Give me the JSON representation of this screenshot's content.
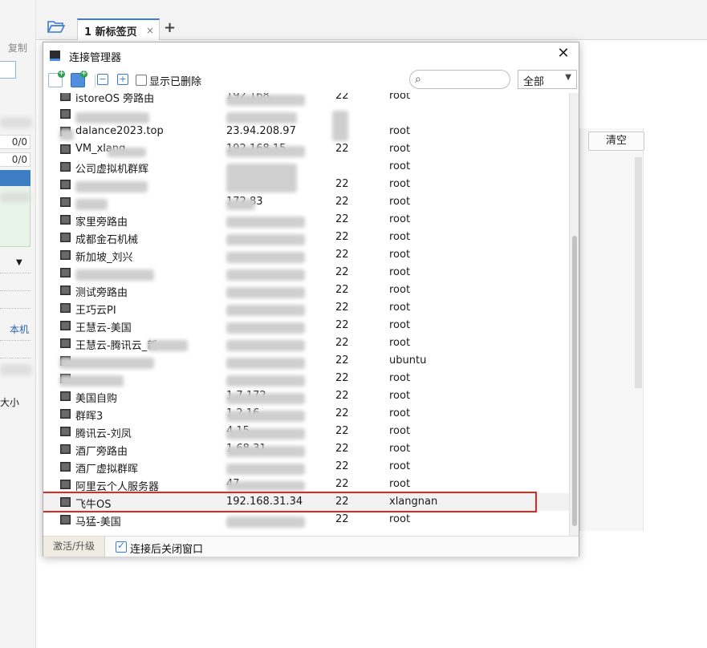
{
  "background": {
    "copy_label": "复制",
    "left_values": [
      "0/0",
      "0/0"
    ],
    "local_label": "本机",
    "size_label": "大小",
    "tab": {
      "label": "1 新标签页",
      "close": "×",
      "add": "+"
    },
    "clear_button": "清空"
  },
  "dialog": {
    "title": "连接管理器",
    "close": "✕",
    "toolbar": {
      "show_deleted_label": "显示已删除",
      "search_placeholder": "",
      "filter_value": "全部"
    },
    "connections": [
      {
        "name": "istoreOS 旁路由",
        "host": "192.168.",
        "port": "22",
        "user": "root"
      },
      {
        "name": "",
        "host": "",
        "port": "",
        "user": ""
      },
      {
        "name": "dalance2023.top",
        "host": "23.94.208.97",
        "port": "",
        "user": "root"
      },
      {
        "name": "VM_xlang",
        "host": "192.168.15.",
        "port": "22",
        "user": "root"
      },
      {
        "name": "公司虚拟机群辉",
        "host": "",
        "port": "",
        "user": "root"
      },
      {
        "name": "",
        "host": "",
        "port": "22",
        "user": "root"
      },
      {
        "name": "",
        "host": "172.83",
        "port": "22",
        "user": "root"
      },
      {
        "name": "家里旁路由",
        "host": "",
        "port": "22",
        "user": "root"
      },
      {
        "name": "成都金石机械",
        "host": "",
        "port": "22",
        "user": "root"
      },
      {
        "name": "新加坡_刘兴",
        "host": "",
        "port": "22",
        "user": "root"
      },
      {
        "name": "",
        "host": "",
        "port": "22",
        "user": "root"
      },
      {
        "name": "测试旁路由",
        "host": "",
        "port": "22",
        "user": "root"
      },
      {
        "name": "王巧云PI",
        "host": "",
        "port": "22",
        "user": "root"
      },
      {
        "name": "王慧云-美国",
        "host": "",
        "port": "22",
        "user": "root"
      },
      {
        "name": "王慧云-腾讯云_新",
        "host": "",
        "port": "22",
        "user": "root"
      },
      {
        "name": "",
        "host": "",
        "port": "22",
        "user": "ubuntu"
      },
      {
        "name": "",
        "host": "",
        "port": "22",
        "user": "root"
      },
      {
        "name": "美国自购",
        "host": "1 7.172",
        "port": "22",
        "user": "root"
      },
      {
        "name": "群晖3",
        "host": "1 2.16",
        "port": "22",
        "user": "root"
      },
      {
        "name": "腾讯云-刘凤",
        "host": "4 15",
        "port": "22",
        "user": "root"
      },
      {
        "name": "酒厂旁路由",
        "host": "1 68.31",
        "port": "22",
        "user": "root"
      },
      {
        "name": "酒厂虚拟群晖",
        "host": "",
        "port": "22",
        "user": "root"
      },
      {
        "name": "阿里云个人服务器",
        "host": "47.",
        "port": "22",
        "user": "root"
      },
      {
        "name": "飞牛OS",
        "host": "192.168.31.34",
        "port": "22",
        "user": "xlangnan"
      },
      {
        "name": "马猛-美国",
        "host": "",
        "port": "22",
        "user": "root"
      }
    ],
    "footer": {
      "activate_label": "激活/升级",
      "close_after_connect_label": "连接后关闭窗口"
    }
  }
}
